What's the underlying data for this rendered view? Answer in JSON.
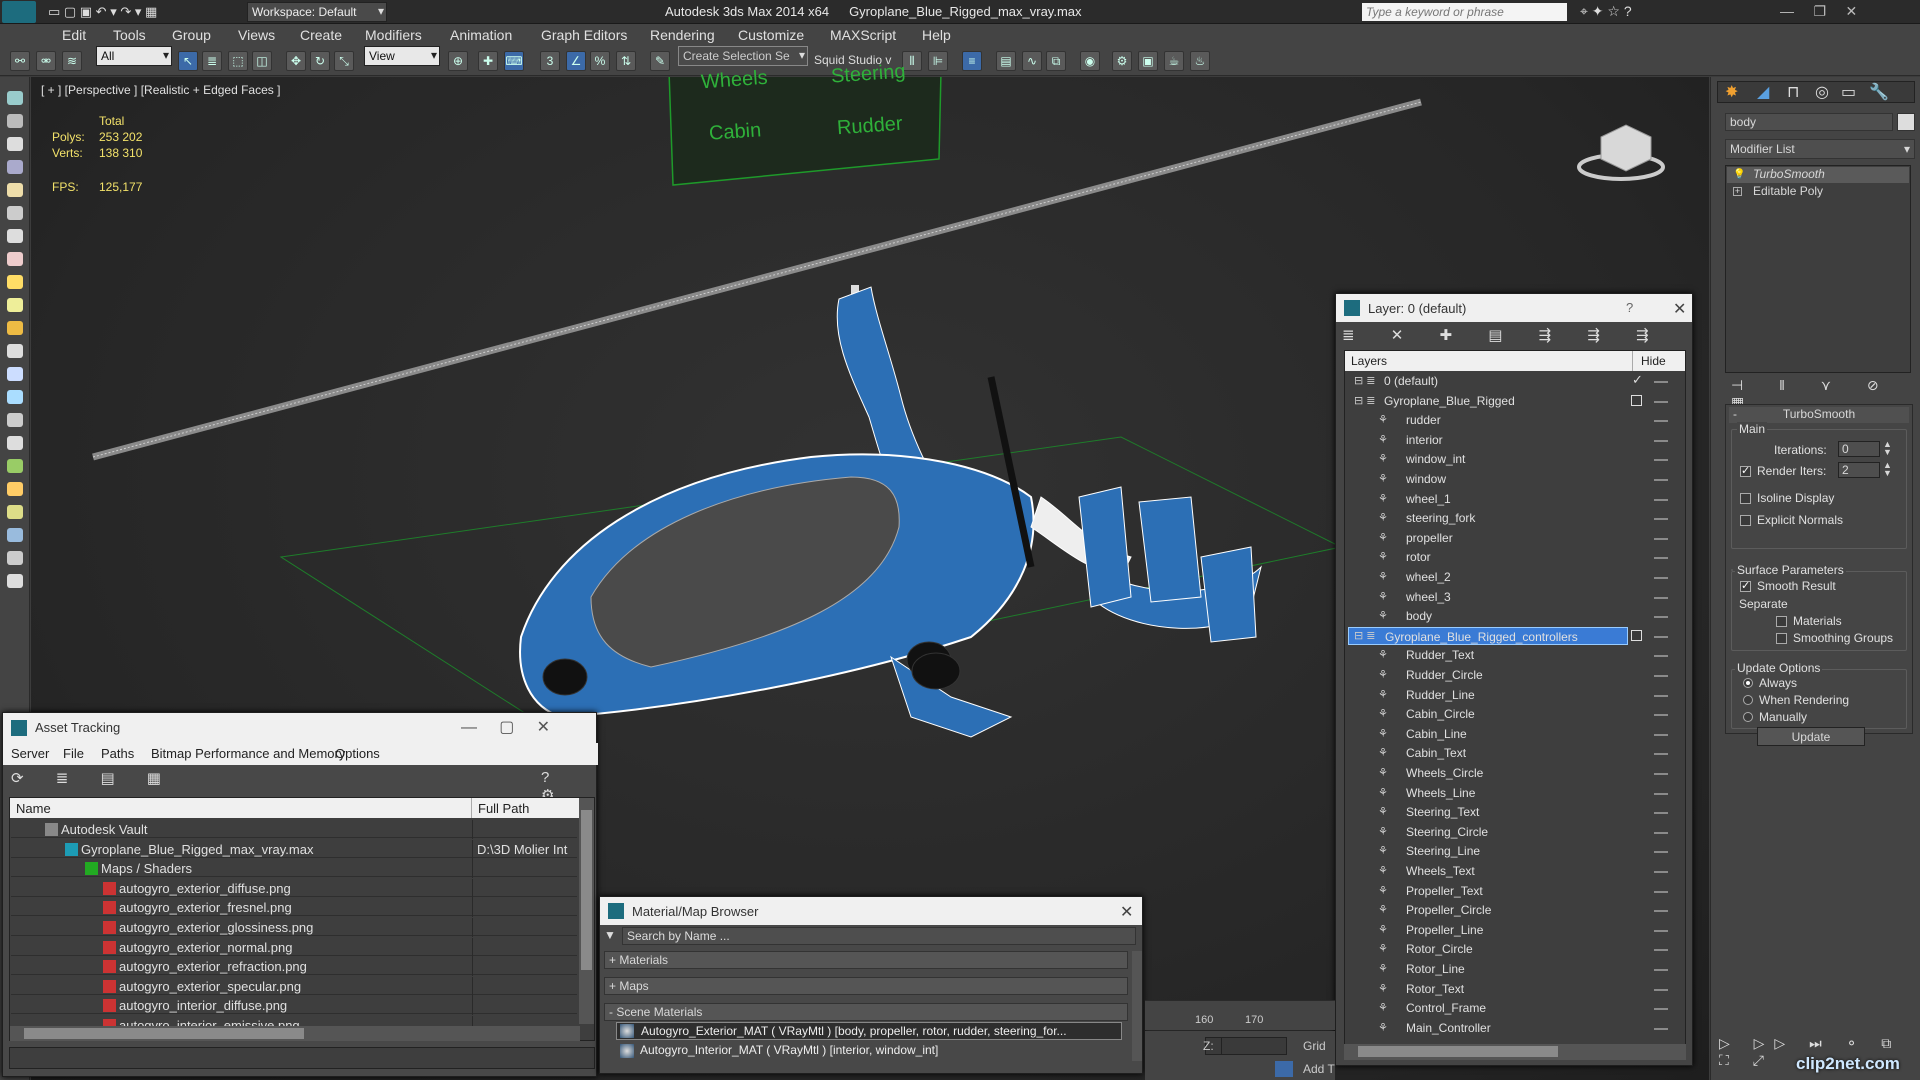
{
  "titlebar": {
    "app": "Autodesk 3ds Max  2014 x64",
    "file": "Gyroplane_Blue_Rigged_max_vray.max",
    "workspace": "Workspace: Default",
    "search_placeholder": "Type a keyword or phrase"
  },
  "menu": [
    "Edit",
    "Tools",
    "Group",
    "Views",
    "Create",
    "Modifiers",
    "Animation",
    "Graph Editors",
    "Rendering",
    "Customize",
    "MAXScript",
    "Help"
  ],
  "toolbar": {
    "filter": "All",
    "refcoord": "View",
    "selection_set": "Create Selection Se",
    "studio": "Squid Studio v"
  },
  "viewport": {
    "label": "[ + ] [Perspective ] [Realistic + Edged Faces ]",
    "total_label": "Total",
    "polys_label": "Polys:",
    "polys": "253 202",
    "verts_label": "Verts:",
    "verts": "138 310",
    "fps_label": "FPS:",
    "fps": "125,177",
    "board": [
      "Wheels",
      "Steering",
      "Cabin",
      "Rudder"
    ]
  },
  "modify": {
    "search": "body",
    "modifier_list": "Modifier List",
    "stack": [
      "TurboSmooth",
      "Editable Poly"
    ],
    "rollout": "TurboSmooth",
    "main": "Main",
    "iterations_label": "Iterations:",
    "iterations": "0",
    "render_iters_label": "Render Iters:",
    "render_iters": "2",
    "isoline": "Isoline Display",
    "explicit": "Explicit Normals",
    "surface": "Surface Parameters",
    "smooth": "Smooth Result",
    "separate": "Separate",
    "materials": "Materials",
    "smoothing": "Smoothing Groups",
    "update_options": "Update Options",
    "always": "Always",
    "when_rendering": "When Rendering",
    "manually": "Manually",
    "update_btn": "Update"
  },
  "layer": {
    "title": "Layer: 0 (default)",
    "question": "?",
    "col_layers": "Layers",
    "col_hide": "Hide",
    "items": [
      {
        "name": "0 (default)",
        "level": 0
      },
      {
        "name": "Gyroplane_Blue_Rigged",
        "level": 0
      },
      {
        "name": "rudder",
        "level": 1
      },
      {
        "name": "interior",
        "level": 1
      },
      {
        "name": "window_int",
        "level": 1
      },
      {
        "name": "window",
        "level": 1
      },
      {
        "name": "wheel_1",
        "level": 1
      },
      {
        "name": "steering_fork",
        "level": 1
      },
      {
        "name": "propeller",
        "level": 1
      },
      {
        "name": "rotor",
        "level": 1
      },
      {
        "name": "wheel_2",
        "level": 1
      },
      {
        "name": "wheel_3",
        "level": 1
      },
      {
        "name": "body",
        "level": 1
      },
      {
        "name": "Gyroplane_Blue_Rigged_controllers",
        "level": 0
      },
      {
        "name": "Rudder_Text",
        "level": 1
      },
      {
        "name": "Rudder_Circle",
        "level": 1
      },
      {
        "name": "Rudder_Line",
        "level": 1
      },
      {
        "name": "Cabin_Circle",
        "level": 1
      },
      {
        "name": "Cabin_Line",
        "level": 1
      },
      {
        "name": "Cabin_Text",
        "level": 1
      },
      {
        "name": "Wheels_Circle",
        "level": 1
      },
      {
        "name": "Wheels_Line",
        "level": 1
      },
      {
        "name": "Steering_Text",
        "level": 1
      },
      {
        "name": "Steering_Circle",
        "level": 1
      },
      {
        "name": "Steering_Line",
        "level": 1
      },
      {
        "name": "Wheels_Text",
        "level": 1
      },
      {
        "name": "Propeller_Text",
        "level": 1
      },
      {
        "name": "Propeller_Circle",
        "level": 1
      },
      {
        "name": "Propeller_Line",
        "level": 1
      },
      {
        "name": "Rotor_Circle",
        "level": 1
      },
      {
        "name": "Rotor_Line",
        "level": 1
      },
      {
        "name": "Rotor_Text",
        "level": 1
      },
      {
        "name": "Control_Frame",
        "level": 1
      },
      {
        "name": "Main_Controller",
        "level": 1
      }
    ]
  },
  "asset": {
    "title": "Asset Tracking",
    "menu": [
      "Server",
      "File",
      "Paths",
      "Bitmap Performance and Memory",
      "Options"
    ],
    "col_name": "Name",
    "col_path": "Full Path",
    "rows": [
      {
        "name": "Autodesk Vault",
        "path": "",
        "level": 0
      },
      {
        "name": "Gyroplane_Blue_Rigged_max_vray.max",
        "path": "D:\\3D Molier Int",
        "level": 1
      },
      {
        "name": "Maps / Shaders",
        "path": "",
        "level": 2
      },
      {
        "name": "autogyro_exterior_diffuse.png",
        "path": "",
        "level": 3
      },
      {
        "name": "autogyro_exterior_fresnel.png",
        "path": "",
        "level": 3
      },
      {
        "name": "autogyro_exterior_glossiness.png",
        "path": "",
        "level": 3
      },
      {
        "name": "autogyro_exterior_normal.png",
        "path": "",
        "level": 3
      },
      {
        "name": "autogyro_exterior_refraction.png",
        "path": "",
        "level": 3
      },
      {
        "name": "autogyro_exterior_specular.png",
        "path": "",
        "level": 3
      },
      {
        "name": "autogyro_interior_diffuse.png",
        "path": "",
        "level": 3
      },
      {
        "name": "autogyro_interior_emissive.png",
        "path": "",
        "level": 3
      }
    ]
  },
  "material": {
    "title": "Material/Map Browser",
    "search": "Search by Name ...",
    "sections": [
      "+ Materials",
      "+ Maps",
      "- Scene Materials"
    ],
    "items": [
      "Autogyro_Exterior_MAT ( VRayMtl ) [body, propeller, rotor, rudder, steering_for...",
      "Autogyro_Interior_MAT ( VRayMtl ) [interior, window_int]"
    ]
  },
  "timeline": {
    "ticks": [
      "160",
      "170"
    ],
    "z_label": "Z:",
    "grid_label": "Grid",
    "add_label": "Add T"
  },
  "watermark": "clip2net.com",
  "colors": {
    "accent": "#3c6aa8",
    "selection": "#3a7bd5",
    "wire": "#ffffff",
    "body": "#2c6fb5"
  }
}
